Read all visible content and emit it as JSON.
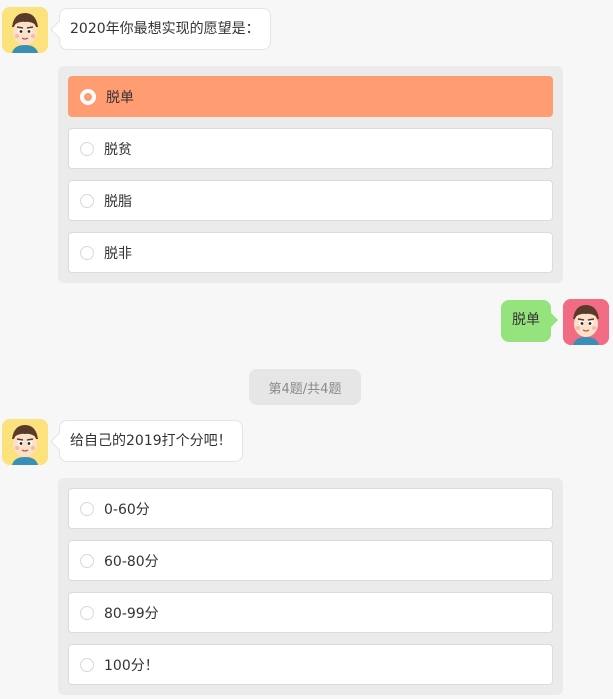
{
  "colors": {
    "background": "#f7f7f7",
    "selected_option": "#ff9c72",
    "user_bubble": "#95e37d",
    "bot_avatar_bg": "#fbe27c",
    "user_avatar_bg": "#f26b84"
  },
  "question1": {
    "prompt": "2020年你最想实现的愿望是：",
    "options": [
      {
        "label": "脱单",
        "selected": true
      },
      {
        "label": "脱贫",
        "selected": false
      },
      {
        "label": "脱脂",
        "selected": false
      },
      {
        "label": "脱非",
        "selected": false
      }
    ]
  },
  "user_reply": {
    "text": "脱单"
  },
  "progress": {
    "text": "第4题/共4题"
  },
  "question2": {
    "prompt": "给自己的2019打个分吧！",
    "options": [
      {
        "label": "0-60分",
        "selected": false
      },
      {
        "label": "60-80分",
        "selected": false
      },
      {
        "label": "80-99分",
        "selected": false
      },
      {
        "label": "100分！",
        "selected": false
      }
    ]
  },
  "icons": {
    "bot_avatar": "cartoon-boy-avatar-icon",
    "user_avatar": "cartoon-boy-avatar-icon",
    "radio": "radio-circle-icon"
  }
}
